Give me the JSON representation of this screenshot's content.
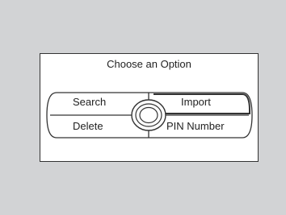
{
  "dialog": {
    "title": "Choose an Option",
    "options": {
      "search": "Search",
      "import": "Import",
      "delete": "Delete",
      "pin": "PIN Number"
    },
    "selected": "import",
    "center_control": "rotary-dial-icon"
  },
  "colors": {
    "background": "#d2d3d5",
    "panel": "#ffffff",
    "outline": "#333333"
  }
}
